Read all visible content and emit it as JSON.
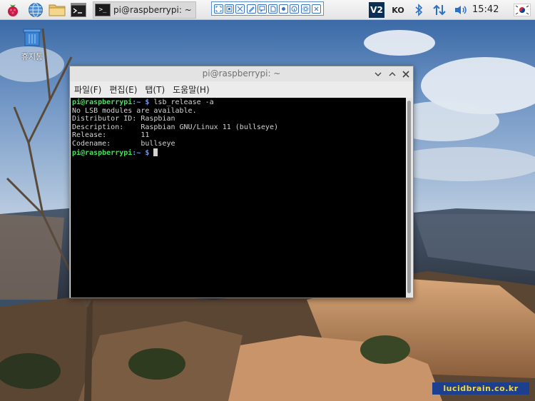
{
  "taskbar": {
    "task_title": "pi@raspberrypi: ~",
    "clock": "15:42",
    "input_method": "KO",
    "vnc_label": "V2"
  },
  "desktop": {
    "trash_label": "휴지통"
  },
  "window": {
    "title": "pi@raspberrypi: ~",
    "menus": [
      "파일(F)",
      "편집(E)",
      "탭(T)",
      "도움말(H)"
    ]
  },
  "terminal": {
    "prompt_user": "pi@raspberrypi",
    "prompt_dir": ":~ $",
    "command": " lsb_release -a",
    "output": [
      "No LSB modules are available.",
      "Distributor ID: Raspbian",
      "Description:    Raspbian GNU/Linux 11 (bullseye)",
      "Release:        11",
      "Codename:       bullseye"
    ]
  },
  "watermark": "lucidbrain.co.kr",
  "colors": {
    "prompt_user": "#47e05a",
    "prompt_dir": "#6e96e8",
    "terminal_bg": "#000000"
  }
}
